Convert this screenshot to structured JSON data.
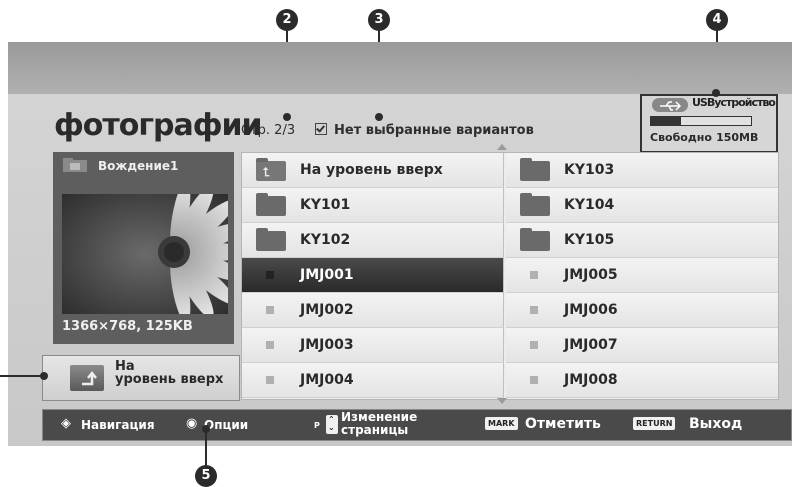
{
  "header": {
    "title": "фотографии",
    "page_info": "Стр. 2/3",
    "selection_info": "Нет выбранные вариантов"
  },
  "usb": {
    "label": "USBустройство",
    "free_text": "Свободно",
    "free_value": "150MB",
    "usage_fraction": 0.3
  },
  "preview": {
    "name": "Вождение1",
    "info": "1366×768, 125KB"
  },
  "up_button": {
    "line1": "На",
    "line2": "уровень вверх"
  },
  "grid": {
    "items": [
      {
        "label": "На уровень вверх",
        "kind": "up"
      },
      {
        "label": "KY103",
        "kind": "folder"
      },
      {
        "label": "KY101",
        "kind": "folder"
      },
      {
        "label": "KY104",
        "kind": "folder"
      },
      {
        "label": "KY102",
        "kind": "folder"
      },
      {
        "label": "KY105",
        "kind": "folder"
      },
      {
        "label": "JMJ001",
        "kind": "photo",
        "selected": true
      },
      {
        "label": "JMJ005",
        "kind": "photo"
      },
      {
        "label": "JMJ002",
        "kind": "photo"
      },
      {
        "label": "JMJ006",
        "kind": "photo"
      },
      {
        "label": "JMJ003",
        "kind": "photo"
      },
      {
        "label": "JMJ007",
        "kind": "photo"
      },
      {
        "label": "JMJ004",
        "kind": "photo"
      },
      {
        "label": "JMJ008",
        "kind": "photo"
      }
    ]
  },
  "bottom_bar": {
    "navigation": "Навигация",
    "options": "Опции",
    "p_key": "P",
    "page_change_line1": "Изменение",
    "page_change_line2": "страницы",
    "mark_key": "MARK",
    "mark_label": "Отметить",
    "return_key": "RETURN",
    "return_label": "Выход"
  },
  "callouts": [
    "2",
    "3",
    "4",
    "5"
  ]
}
